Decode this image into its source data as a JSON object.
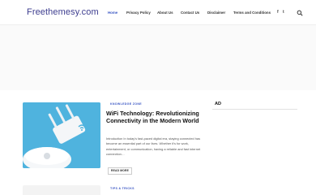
{
  "header": {
    "logo": "Freethemesy.com",
    "nav": [
      {
        "label": "Home",
        "active": true
      },
      {
        "label": "Privacy Policy",
        "active": false
      },
      {
        "label": "About Us",
        "active": false
      },
      {
        "label": "Contact Us",
        "active": false
      },
      {
        "label": "Disclaimer",
        "active": false
      },
      {
        "label": "Terms and Conditions",
        "active": false
      }
    ],
    "social": [
      {
        "icon": "facebook-icon",
        "glyph": "f"
      },
      {
        "icon": "twitter-icon",
        "glyph": "t"
      }
    ],
    "search_icon": "search-icon"
  },
  "post": {
    "category": "KNOWLEDGE ZONE",
    "title": "WiFi Technology: Revolutionizing Connectivity in the Modern World",
    "excerpt": "Introduction In today's fast-paced digital era, staying connected has become an essential part of our lives. Whether it's for work, entertainment, or communication, having a reliable and fast internet connection…",
    "read_more": "READ MORE"
  },
  "sidebar": {
    "ad_heading": "AD"
  },
  "post2": {
    "category": "TIPS & TRICKS"
  },
  "colors": {
    "accent": "#3b57c4",
    "logo": "#3d3d8f",
    "thumb_bg": "#4fb3de"
  }
}
